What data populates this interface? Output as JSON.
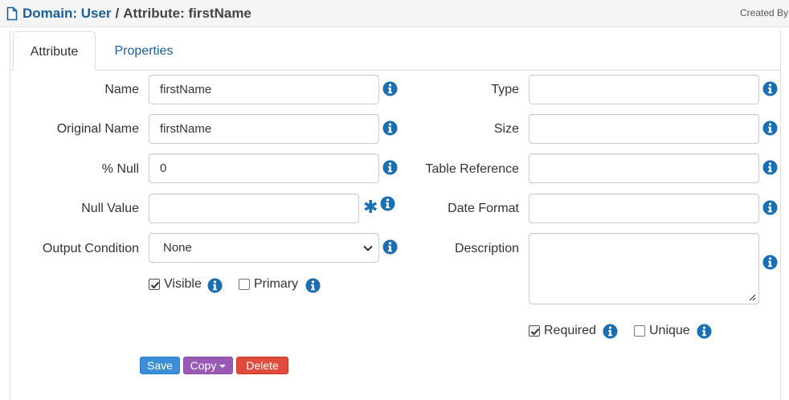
{
  "header": {
    "breadcrumb_domain": "Domain: User",
    "separator": "/",
    "breadcrumb_attribute": "Attribute: firstName",
    "created_by_label": "Created By"
  },
  "tabs": [
    {
      "label": "Attribute",
      "active": true
    },
    {
      "label": "Properties",
      "active": false
    }
  ],
  "left_fields": {
    "name": {
      "label": "Name",
      "value": "firstName"
    },
    "original_name": {
      "label": "Original Name",
      "value": "firstName"
    },
    "pct_null": {
      "label": "% Null",
      "value": "0"
    },
    "null_value": {
      "label": "Null Value",
      "value": ""
    },
    "output_condition": {
      "label": "Output Condition",
      "selected": "None"
    }
  },
  "right_fields": {
    "type": {
      "label": "Type",
      "value": ""
    },
    "size": {
      "label": "Size",
      "value": ""
    },
    "table_reference": {
      "label": "Table Reference",
      "value": ""
    },
    "date_format": {
      "label": "Date Format",
      "value": ""
    },
    "description": {
      "label": "Description",
      "value": ""
    }
  },
  "checkboxes": {
    "visible": {
      "label": "Visible",
      "checked": true
    },
    "primary": {
      "label": "Primary",
      "checked": false
    },
    "required": {
      "label": "Required",
      "checked": true
    },
    "unique": {
      "label": "Unique",
      "checked": false
    }
  },
  "buttons": {
    "save": "Save",
    "copy": "Copy",
    "delete": "Delete"
  },
  "colors": {
    "link": "#1a5e9a",
    "info_icon": "#1a6fb3",
    "save": "#3b8fd8",
    "copy": "#9b59b6",
    "delete": "#e14b3b"
  },
  "icons": {
    "document": "document-icon",
    "info": "info-icon",
    "required_marker": "asterisk-icon",
    "dropdown": "chevron-down-icon",
    "copy_menu": "caret-down-icon"
  }
}
